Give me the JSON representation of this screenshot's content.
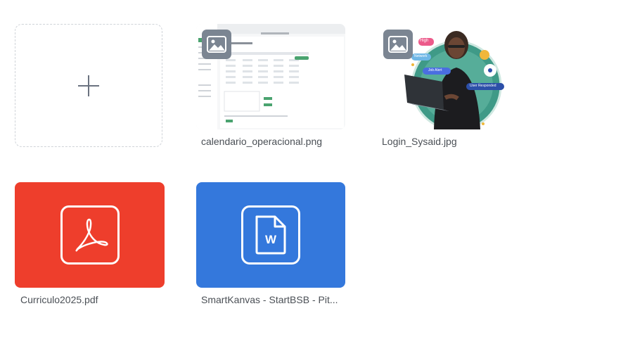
{
  "tiles": {
    "add": {
      "icon": "plus-icon"
    },
    "calendario": {
      "filename": "calendario_operacional.png",
      "badge_icon": "image-icon",
      "preview": {
        "heading": "Calendario operacional",
        "rows": [
          "Seg",
          "Ter",
          "Qua",
          "Qui",
          "Sex",
          "Sab",
          "Dom"
        ]
      }
    },
    "login": {
      "filename": "Login_Sysaid.jpg",
      "badge_icon": "image-icon",
      "preview": {
        "tag_high": "High",
        "tag_network": "Network",
        "tag_job": "Job Alert",
        "tag_responded": "User Responded"
      }
    },
    "pdf": {
      "filename": "Curriculo2025.pdf",
      "icon": "pdf-icon",
      "color": "#EE3E2C"
    },
    "doc": {
      "filename": "SmartKanvas - StartBSB - Pit...",
      "icon": "word-doc-icon",
      "letter": "W",
      "color": "#3478DC"
    }
  }
}
